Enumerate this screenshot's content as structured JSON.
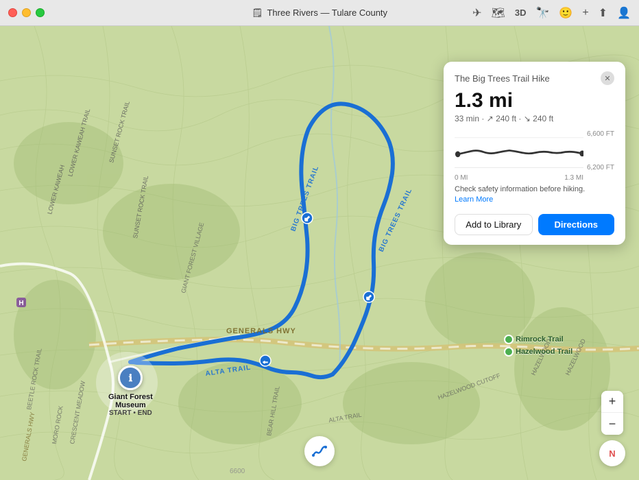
{
  "titlebar": {
    "title": "Three Rivers — Tulare County",
    "icon_label": "map-icon"
  },
  "toolbar": {
    "directions_icon": "✈",
    "map_icon": "🗺",
    "threed_label": "3D",
    "binoculars_icon": "🔭",
    "smiley_icon": "🙂",
    "plus_icon": "+",
    "share_icon": "⬆",
    "account_icon": "👤"
  },
  "map": {
    "background_color": "#c8d9a0"
  },
  "info_card": {
    "title": "The Big Trees Trail Hike",
    "distance": "1.3 mi",
    "meta": "33 min · ↗ 240 ft · ↘ 240 ft",
    "elevation_high": "6,600 FT",
    "elevation_low": "6,200 FT",
    "dist_start": "0 MI",
    "dist_end": "1.3 MI",
    "safety_text": "Check safety information before hiking.",
    "learn_more": "Learn More",
    "add_to_library": "Add to Library",
    "directions": "Directions"
  },
  "place": {
    "name": "Giant Forest\nMuseum",
    "sublabel": "START • END"
  },
  "trails": [
    {
      "name": "Rimrock Trail"
    },
    {
      "name": "Hazelwood Trail"
    }
  ],
  "map_labels": [
    "BIG TREES TRAIL",
    "ALTA TRAIL",
    "GENERALS HWY",
    "LOWER KAWEAH TRAIL",
    "SUNSET ROCK TRAIL"
  ],
  "controls": {
    "zoom_in": "+",
    "zoom_out": "−",
    "compass": "N"
  }
}
